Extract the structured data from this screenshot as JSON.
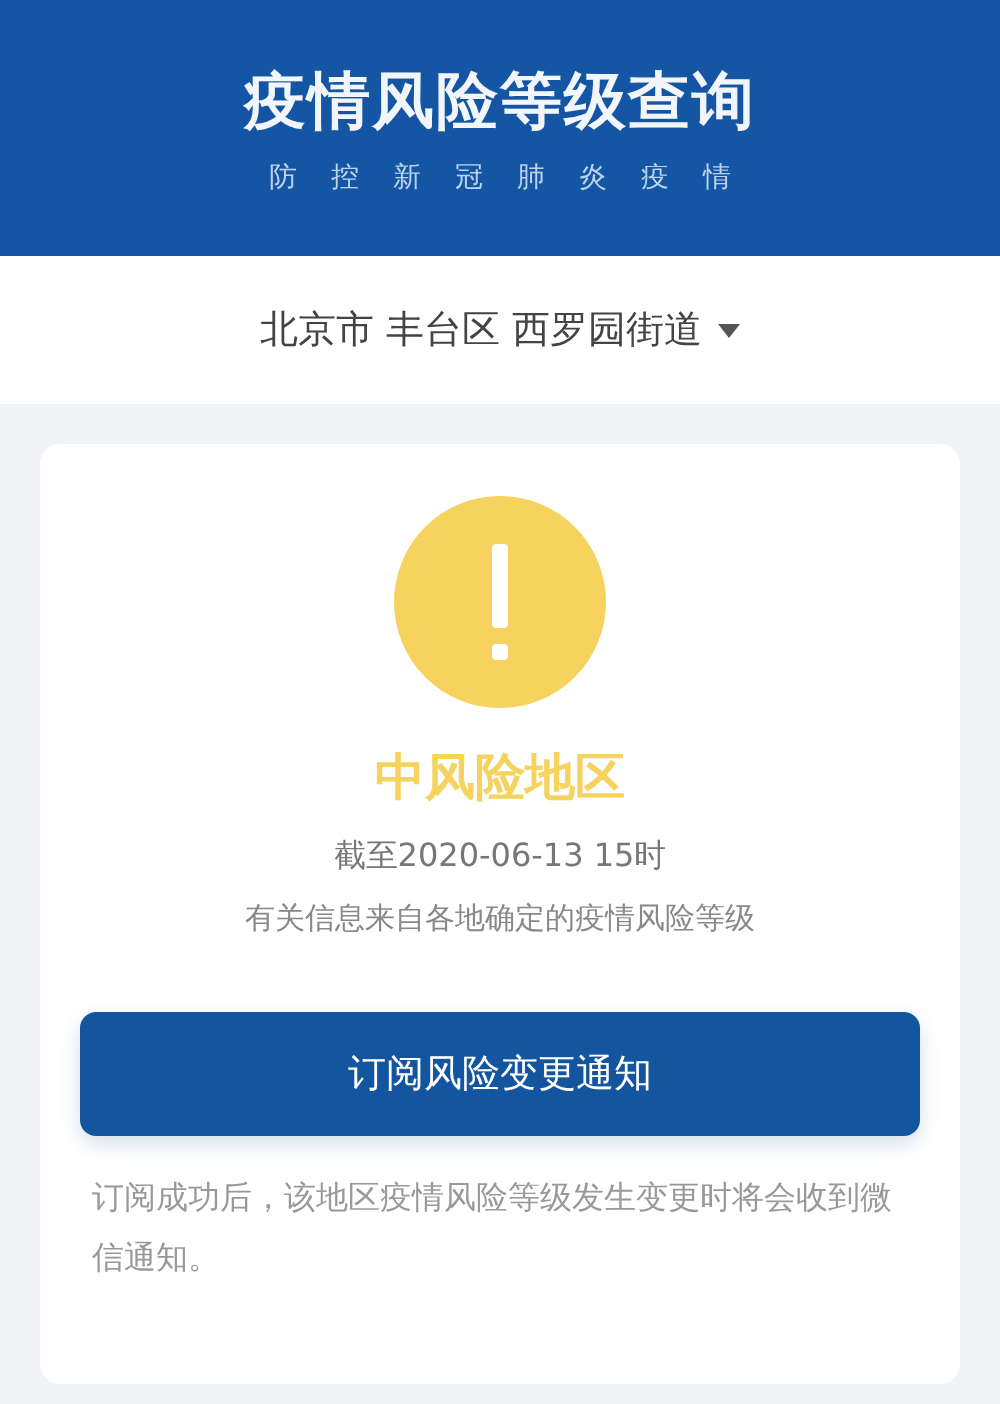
{
  "header": {
    "title": "疫情风险等级查询",
    "subtitle": "防控新冠肺炎疫情"
  },
  "location": {
    "text": "北京市 丰台区 西罗园街道"
  },
  "result": {
    "kind": "medium",
    "label": "中风险地区",
    "updated": "截至2020-06-13 15时",
    "source": "有关信息来自各地确定的疫情风险等级"
  },
  "subscribe_button": "订阅风险变更通知",
  "note": "订阅成功后，该地区疫情风险等级发生变更时将会收到微信通知。"
}
